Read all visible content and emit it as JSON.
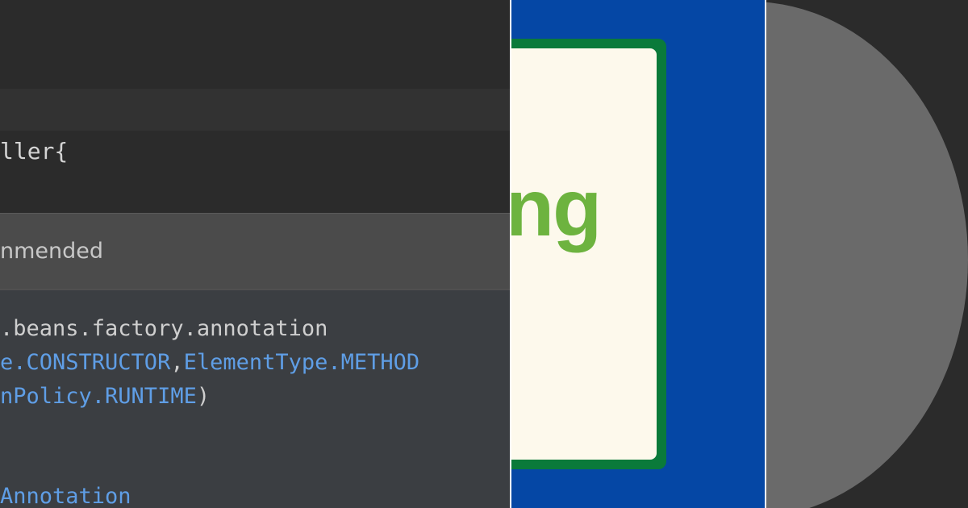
{
  "editor": {
    "code_line": "ller{"
  },
  "popup": {
    "header": "nmended",
    "doc_lines": {
      "line1": ".beans.factory.annotation",
      "line2_a": "e.CONSTRUCTOR",
      "line2_sep": ",",
      "line2_b": "ElementType.METHOD",
      "line3_a": "nPolicy.RUNTIME",
      "line3_close": ")",
      "line4": "Annotation"
    }
  },
  "logo": {
    "text": "ng"
  },
  "colors": {
    "editor_bg": "#2b2b2b",
    "popup_header_bg": "#4b4b4b",
    "popup_body_bg": "#3b3e42",
    "keyword_blue": "#5f9ee6",
    "logo_panel_blue": "#0547a5",
    "logo_card_border_green": "#0a7a3a",
    "logo_card_bg": "#fdf9ec",
    "logo_text_green": "#6db33f",
    "disc_grey": "#6a6a6a"
  }
}
